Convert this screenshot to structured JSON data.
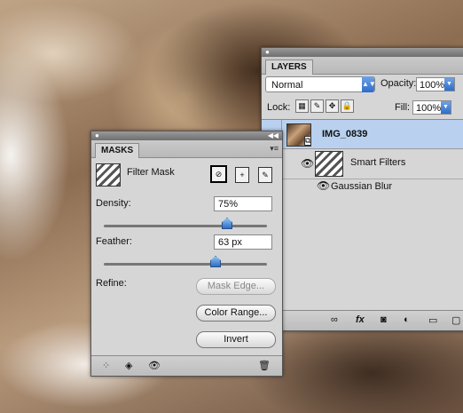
{
  "layers": {
    "tab": "LAYERS",
    "blend_mode": "Normal",
    "opacity_label": "Opacity:",
    "opacity_value": "100%",
    "lock_label": "Lock:",
    "fill_label": "Fill:",
    "fill_value": "100%",
    "layer_name": "IMG_0839",
    "smart_filters_label": "Smart Filters",
    "filter_name": "Gaussian Blur",
    "bottom_icons": [
      "link-icon",
      "fx-icon",
      "add-mask-icon",
      "adjustment-icon",
      "group-folder-icon",
      "new-layer-icon"
    ]
  },
  "masks": {
    "tab": "MASKS",
    "mask_type": "Filter Mask",
    "density_label": "Density:",
    "density_value": "75%",
    "density_fraction": 0.75,
    "feather_label": "Feather:",
    "feather_value": "63 px",
    "feather_fraction": 0.68,
    "refine_label": "Refine:",
    "mask_edge_label": "Mask Edge...",
    "color_range_label": "Color Range...",
    "invert_label": "Invert",
    "bottom_icons": [
      "load-selection-icon",
      "apply-mask-icon",
      "visibility-eye-icon",
      "trash-icon"
    ]
  }
}
